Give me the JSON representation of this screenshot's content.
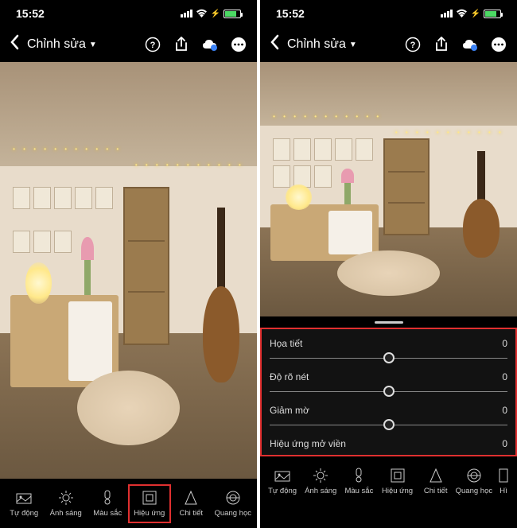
{
  "status": {
    "time": "15:52"
  },
  "header": {
    "title": "Chỉnh sửa"
  },
  "tools": [
    {
      "label": "Tự động",
      "icon": "auto"
    },
    {
      "label": "Ánh sáng",
      "icon": "light"
    },
    {
      "label": "Màu sắc",
      "icon": "color"
    },
    {
      "label": "Hiệu ứng",
      "icon": "effects"
    },
    {
      "label": "Chi tiết",
      "icon": "detail"
    },
    {
      "label": "Quang học",
      "icon": "optics"
    }
  ],
  "tools_overflow_label": "Hì",
  "selected_tool_index": 3,
  "sliders": [
    {
      "label": "Họa tiết",
      "value": "0"
    },
    {
      "label": "Độ rõ nét",
      "value": "0"
    },
    {
      "label": "Giảm mờ",
      "value": "0"
    },
    {
      "label": "Hiệu ứng mở viền",
      "value": "0"
    }
  ]
}
